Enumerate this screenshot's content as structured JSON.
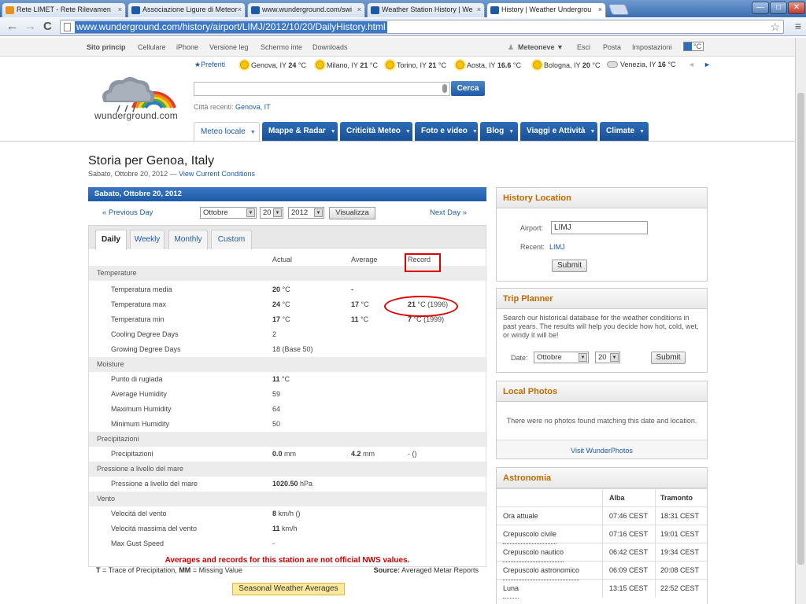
{
  "browser": {
    "tabs": [
      {
        "label": "Rete LIMET - Rete Rilevamen",
        "close": "×"
      },
      {
        "label": "Associazione Ligure di Meteor",
        "close": "×"
      },
      {
        "label": "www.wunderground.com/swi",
        "close": "×"
      },
      {
        "label": "Weather Station History | We",
        "close": "×"
      },
      {
        "label": "History | Weather Undergrou",
        "close": "×"
      }
    ],
    "url": "www.wunderground.com/history/airport/LIMJ/2012/10/20/DailyHistory.html",
    "back": "←",
    "forward": "→",
    "reload": "C",
    "star": "☆",
    "wrench": "≡",
    "win_min": "—",
    "win_max": "□",
    "win_close": "✕"
  },
  "toplinks": {
    "items": [
      "Sito princip",
      "Cellulare",
      "iPhone",
      "Versione leg",
      "Schermo inte",
      "Downloads"
    ],
    "user": "Meteoneve ▼",
    "esci": "Esci",
    "posta": "Posta",
    "impostazioni": "Impostazioni",
    "unit": "°C"
  },
  "logo": {
    "text": "wunderground.com"
  },
  "favbar": {
    "preferiti": "★Preferiti",
    "cities": [
      {
        "name": "Genova, IY ",
        "temp": "24",
        "unit": " °C"
      },
      {
        "name": "Milano, IY ",
        "temp": "21",
        "unit": " °C"
      },
      {
        "name": "Torino, IY ",
        "temp": "21",
        "unit": " °C"
      },
      {
        "name": "Aosta, IY ",
        "temp": "16.6",
        "unit": " °C"
      },
      {
        "name": "Bologna, IY ",
        "temp": "20",
        "unit": " °C"
      },
      {
        "name": "Venezia, IY ",
        "temp": "16",
        "unit": " °C"
      }
    ],
    "prev": "◄",
    "next": "►"
  },
  "search": {
    "value": "",
    "button": "Cerca",
    "recent_label": "Città recenti:",
    "recent_value": "Genova, IT"
  },
  "mainnav": [
    "Meteo locale",
    "Mappe & Radar",
    "Criticità Meteo",
    "Foto e video",
    "Blog",
    "Viaggi e Attività",
    "Climate"
  ],
  "page": {
    "title": "Storia per Genoa, Italy",
    "subtitle": "Sabato, Ottobre 20, 2012 — ",
    "subtitle_link": "View Current Conditions"
  },
  "history": {
    "header": "Sabato, Ottobre 20, 2012",
    "prev": "« Previous Day",
    "next": "Next Day »",
    "month": "Ottobre",
    "day": "20",
    "year": "2012",
    "visualizza": "Visualizza",
    "tabs": [
      "Daily",
      "Weekly",
      "Monthly",
      "Custom"
    ],
    "columns": {
      "actual": "Actual",
      "average": "Average",
      "record": "Record"
    },
    "rows": [
      {
        "type": "sec",
        "label": "Temperature"
      },
      {
        "type": "row",
        "label": "Temperatura media",
        "actual": "20",
        "actual_unit": " °C",
        "average": "-",
        "average_unit": "",
        "record": "",
        "record_unit": ""
      },
      {
        "type": "row",
        "label": "Temperatura max",
        "actual": "24",
        "actual_unit": " °C",
        "average": "17",
        "average_unit": " °C",
        "record": "21",
        "record_unit": " °C (1996)"
      },
      {
        "type": "row",
        "label": "Temperatura min",
        "actual": "17",
        "actual_unit": " °C",
        "average": "11",
        "average_unit": " °C",
        "record": "7",
        "record_unit": " °C (1999)"
      },
      {
        "type": "row",
        "label": "Cooling Degree Days",
        "actual": "",
        "actual_unit": "2",
        "average": "",
        "average_unit": "",
        "record": "",
        "record_unit": ""
      },
      {
        "type": "row",
        "label": "Growing Degree Days",
        "actual": "",
        "actual_unit": "18 (Base 50)",
        "average": "",
        "average_unit": "",
        "record": "",
        "record_unit": ""
      },
      {
        "type": "sec",
        "label": "Moisture"
      },
      {
        "type": "row",
        "label": "Punto di rugiada",
        "actual": "11",
        "actual_unit": " °C",
        "average": "",
        "average_unit": "",
        "record": "",
        "record_unit": ""
      },
      {
        "type": "row",
        "label": "Average Humidity",
        "actual": "",
        "actual_unit": "59",
        "average": "",
        "average_unit": "",
        "record": "",
        "record_unit": ""
      },
      {
        "type": "row",
        "label": "Maximum Humidity",
        "actual": "",
        "actual_unit": "64",
        "average": "",
        "average_unit": "",
        "record": "",
        "record_unit": ""
      },
      {
        "type": "row",
        "label": "Minimum Humidity",
        "actual": "",
        "actual_unit": "50",
        "average": "",
        "average_unit": "",
        "record": "",
        "record_unit": ""
      },
      {
        "type": "sec",
        "label": "Precipitazioni"
      },
      {
        "type": "row",
        "label": "Precipitazioni",
        "actual": "0.0",
        "actual_unit": " mm",
        "average": "4.2",
        "average_unit": " mm",
        "record": "",
        "record_unit": "- ()"
      },
      {
        "type": "sec",
        "label": "Pressione a livello del mare"
      },
      {
        "type": "row",
        "label": "Pressione a livello del mare",
        "actual": "1020.50",
        "actual_unit": " hPa",
        "average": "",
        "average_unit": "",
        "record": "",
        "record_unit": ""
      },
      {
        "type": "sec",
        "label": "Vento"
      },
      {
        "type": "row",
        "label": "Velocitá del vento",
        "actual": "8",
        "actual_unit": " km/h ()",
        "average": "",
        "average_unit": "",
        "record": "",
        "record_unit": ""
      },
      {
        "type": "row",
        "label": "Velocitá massima del vento",
        "actual": "11",
        "actual_unit": " km/h",
        "average": "",
        "average_unit": "",
        "record": "",
        "record_unit": ""
      },
      {
        "type": "row",
        "label": "Max Gust Speed",
        "actual": "",
        "actual_unit": "-",
        "average": "",
        "average_unit": "",
        "record": "",
        "record_unit": ""
      }
    ],
    "nws_note": "Averages and records for this station are not official NWS values.",
    "legend_t": "T",
    "legend_t_text": " = Trace of Precipitation, ",
    "legend_mm": "MM",
    "legend_mm_text": " = Missing Value",
    "source_label": "Source:",
    "source_value": " Averaged Metar Reports",
    "seasonal": "Seasonal Weather Averages"
  },
  "location_panel": {
    "title": "History Location",
    "airport_label": "Airport:",
    "airport_value": "LIMJ",
    "recent_label": "Recent:",
    "recent_value": "LIMJ",
    "submit": "Submit"
  },
  "trip_panel": {
    "title": "Trip Planner",
    "text": "Search our historical database for the weather conditions in past years. The results will help you decide how hot, cold, wet, or windy it will be!",
    "date_label": "Date:",
    "month": "Ottobre",
    "day": "20",
    "submit": "Submit"
  },
  "photos_panel": {
    "title": "Local Photos",
    "text": "There were no photos found matching this date and location.",
    "link": "Visit WunderPhotos"
  },
  "astro_panel": {
    "title": "Astronomia",
    "col1": "Alba",
    "col2": "Tramonto",
    "rows": [
      {
        "label": "Ora attuale",
        "alba": "07:46 CEST",
        "tramonto": "18:31 CEST"
      },
      {
        "label": "Crepuscolo civile",
        "alba": "07:16 CEST",
        "tramonto": "19:01 CEST"
      },
      {
        "label": "Crepuscolo nautico",
        "alba": "06:42 CEST",
        "tramonto": "19:34 CEST"
      },
      {
        "label": "Crepuscolo astronomico",
        "alba": "06:09 CEST",
        "tramonto": "20:08 CEST"
      },
      {
        "label": "Luna",
        "alba": "13:15 CEST",
        "tramonto": "22:52 CEST"
      }
    ]
  }
}
